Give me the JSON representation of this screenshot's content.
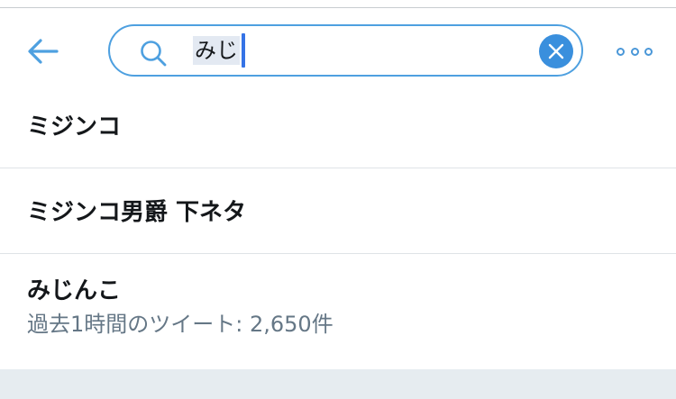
{
  "header": {
    "back_icon": "arrow-left-icon",
    "search": {
      "query": "みじ",
      "icon": "search-icon",
      "clear_icon": "close-icon"
    },
    "more_icon": "more-dots-icon"
  },
  "suggestions": [
    {
      "label": "ミジンコ"
    },
    {
      "label": "ミジンコ男爵 下ネタ"
    },
    {
      "label": "みじんこ",
      "meta": "過去1時間のツイート: 2,650件"
    }
  ],
  "colors": {
    "accent": "#4ea0e0",
    "clear_button": "#3a8fdd",
    "caret": "#3573e6",
    "secondary_text": "#657786",
    "footer_bg": "#e6ecf0"
  }
}
